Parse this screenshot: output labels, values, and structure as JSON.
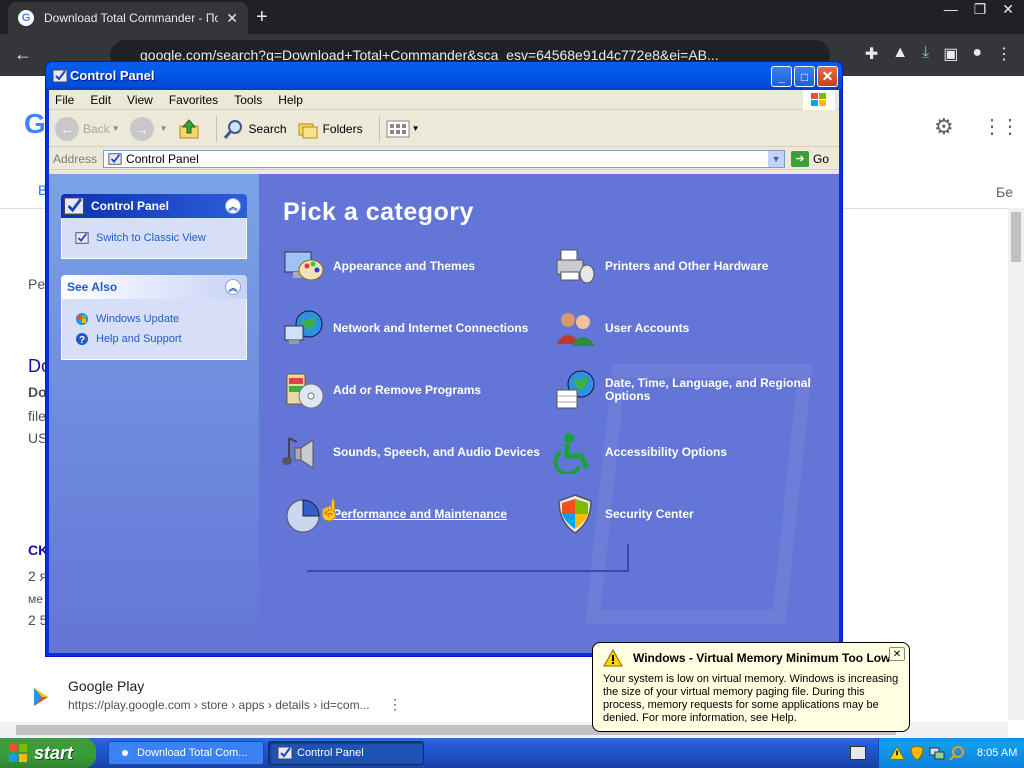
{
  "chrome": {
    "tab_title": "Download Total Commander - Поис",
    "tab_close": "✕",
    "new_tab": "+",
    "url": "google.com/search?q=Download+Total+Commander&sca_esv=64568e91d4c772e8&ei=AB...",
    "win_min": "—",
    "win_restore": "❐",
    "win_close": "✕"
  },
  "background_page": {
    "google_letter": "G",
    "fragments": [
      "Be",
      "Pe",
      "Do",
      "Do",
      "file",
      "US",
      "CK",
      "2 я",
      "ме",
      "2 5"
    ],
    "right_letter": "Бе",
    "google_play_title": "Google Play",
    "google_play_url": "https://play.google.com › store › apps › details › id=com...",
    "more": "⋮"
  },
  "window": {
    "title": "Control Panel",
    "menu": [
      "File",
      "Edit",
      "View",
      "Favorites",
      "Tools",
      "Help"
    ],
    "toolbar": {
      "back": "Back",
      "search": "Search",
      "folders": "Folders"
    },
    "address": {
      "label": "Address",
      "value": "Control Panel",
      "go": "Go"
    },
    "taskpane": {
      "control_panel_header": "Control Panel",
      "switch_view": "Switch to Classic View",
      "see_also_header": "See Also",
      "see_also_items": [
        "Windows Update",
        "Help and Support"
      ]
    },
    "pick_title": "Pick a category",
    "categories": [
      "Appearance and Themes",
      "Printers and Other Hardware",
      "Network and Internet Connections",
      "User Accounts",
      "Add or Remove Programs",
      "Date, Time, Language, and Regional Options",
      "Sounds, Speech, and Audio Devices",
      "Accessibility Options",
      "Performance and Maintenance",
      "Security Center"
    ]
  },
  "taskbar": {
    "start": "start",
    "tasks": [
      "Download Total Com...",
      "Control Panel"
    ],
    "time": "8:05 AM"
  },
  "balloon": {
    "title": "Windows - Virtual Memory Minimum Too Low",
    "body": "Your system is low on virtual memory. Windows is increasing the size of your virtual memory paging file. During this process, memory requests for some applications may be denied. For more information, see Help.",
    "close": "✕"
  },
  "colors": {
    "xp_blue": "#0058ee",
    "category_bg": "#6375d6",
    "taskpane_link": "#215dc6",
    "start_green": "#3a9d3a",
    "balloon_bg": "#ffffe1"
  }
}
